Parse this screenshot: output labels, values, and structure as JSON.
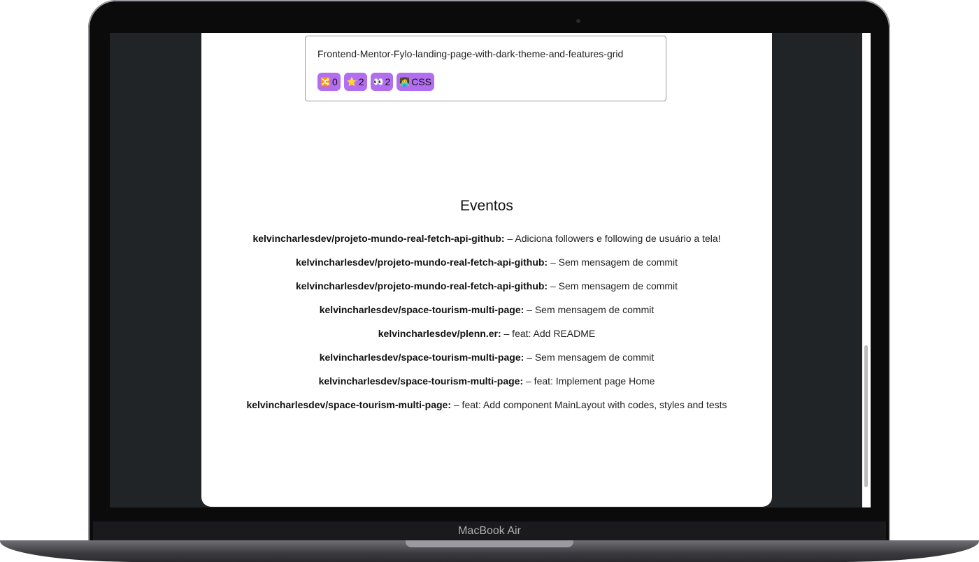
{
  "device": {
    "label": "MacBook Air"
  },
  "repo": {
    "name": "Frontend-Mentor-Fylo-landing-page-with-dark-theme-and-features-grid",
    "badges": [
      {
        "icon": "fork-icon",
        "glyph": "🔀",
        "value": "0"
      },
      {
        "icon": "star-icon",
        "glyph": "⭐",
        "value": "2"
      },
      {
        "icon": "eyes-icon",
        "glyph": "👀",
        "value": "2"
      },
      {
        "icon": "person-icon",
        "glyph": "🧑‍💻",
        "value": "CSS"
      }
    ]
  },
  "events": {
    "title": "Eventos",
    "items": [
      {
        "repo": "kelvincharlesdev/projeto-mundo-real-fetch-api-github:",
        "message": " – Adiciona followers e following de usuário a tela!"
      },
      {
        "repo": "kelvincharlesdev/projeto-mundo-real-fetch-api-github:",
        "message": " – Sem mensagem de commit"
      },
      {
        "repo": "kelvincharlesdev/projeto-mundo-real-fetch-api-github:",
        "message": " – Sem mensagem de commit"
      },
      {
        "repo": "kelvincharlesdev/space-tourism-multi-page:",
        "message": " – Sem mensagem de commit"
      },
      {
        "repo": "kelvincharlesdev/plenn.er:",
        "message": " – feat: Add README"
      },
      {
        "repo": "kelvincharlesdev/space-tourism-multi-page:",
        "message": " – Sem mensagem de commit"
      },
      {
        "repo": "kelvincharlesdev/space-tourism-multi-page:",
        "message": " – feat: Implement page Home"
      },
      {
        "repo": "kelvincharlesdev/space-tourism-multi-page:",
        "message": " – feat: Add component MainLayout with codes, styles and tests"
      }
    ]
  }
}
